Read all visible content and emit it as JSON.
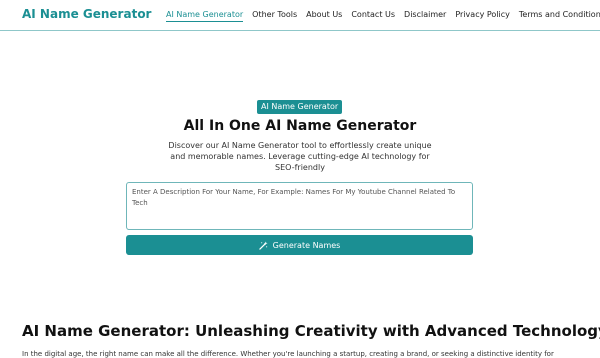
{
  "header": {
    "brand": "AI Name Generator",
    "nav": [
      {
        "label": "AI Name Generator",
        "active": true
      },
      {
        "label": "Other Tools",
        "active": false
      },
      {
        "label": "About Us",
        "active": false
      },
      {
        "label": "Contact Us",
        "active": false
      },
      {
        "label": "Disclaimer",
        "active": false
      },
      {
        "label": "Privacy Policy",
        "active": false
      },
      {
        "label": "Terms and Conditions",
        "active": false
      }
    ]
  },
  "hero": {
    "badge": "AI Name Generator",
    "title": "All In One AI Name Generator",
    "description": "Discover our AI Name Generator tool to effortlessly create unique and memorable names. Leverage cutting-edge AI technology for SEO-friendly"
  },
  "form": {
    "placeholder": "Enter A Description For Your Name, For Example: Names For My Youtube Channel Related To Tech",
    "button_label": "Generate Names",
    "button_icon": "magic-wand-icon"
  },
  "article": {
    "heading": "AI Name Generator: Unleashing Creativity with Advanced Technology",
    "intro": "In the digital age, the right name can make all the difference. Whether you're launching a startup, creating a brand, or seeking a distinctive identity for"
  },
  "colors": {
    "accent": "#1b8f93",
    "border": "#6fb6b9"
  }
}
